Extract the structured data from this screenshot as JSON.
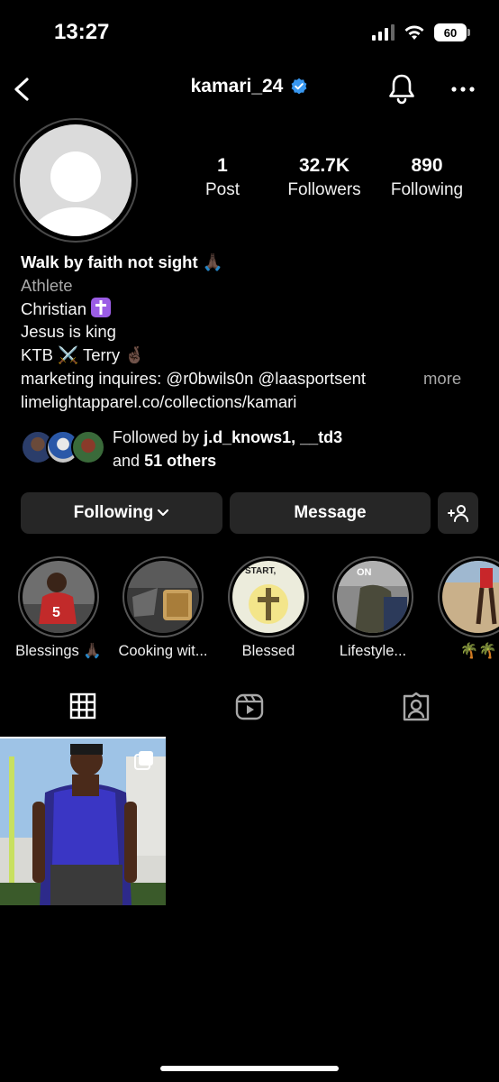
{
  "status_bar": {
    "time": "13:27",
    "battery": "60"
  },
  "header": {
    "username": "kamari_24",
    "verified": true
  },
  "stats": [
    {
      "value": "1",
      "label": "Post"
    },
    {
      "value": "32.7K",
      "label": "Followers"
    },
    {
      "value": "890",
      "label": "Following"
    }
  ],
  "bio": {
    "name_line": "Walk by faith not sight",
    "name_emoji": "🙏🏿",
    "category": "Athlete",
    "line1": "Christian",
    "line1_emoji": "✝️",
    "line2": "Jesus is king",
    "line3_a": "KTB",
    "line3_emoji": "⚔️",
    "line3_b": "Terry",
    "line3_emoji2": "🤞🏿",
    "line4": "marketing inquires: @r0bwils0n @laasportsent",
    "more": "more",
    "link": "limelightapparel.co/collections/kamari"
  },
  "followed_by": {
    "prefix": "Followed by",
    "users": "j.d_knows1, __td3",
    "and": "and",
    "others": "51 others"
  },
  "actions": {
    "following": "Following",
    "message": "Message"
  },
  "highlights": [
    {
      "label": "Blessings 🙏🏿"
    },
    {
      "label": "Cooking wit..."
    },
    {
      "label": "Blessed"
    },
    {
      "label": "Lifestyle..."
    },
    {
      "label": "🌴🌴"
    }
  ],
  "highlight_texts": {
    "blessed_overlay": "START,",
    "lifestyle_overlay": "ON"
  },
  "tabs": [
    {
      "icon": "grid-icon",
      "active": true
    },
    {
      "icon": "reels-icon",
      "active": false
    },
    {
      "icon": "tagged-icon",
      "active": false
    }
  ],
  "colors": {
    "background": "#000000",
    "button": "#262626",
    "verified": "#3897f0",
    "muted": "#a8a8a8"
  }
}
